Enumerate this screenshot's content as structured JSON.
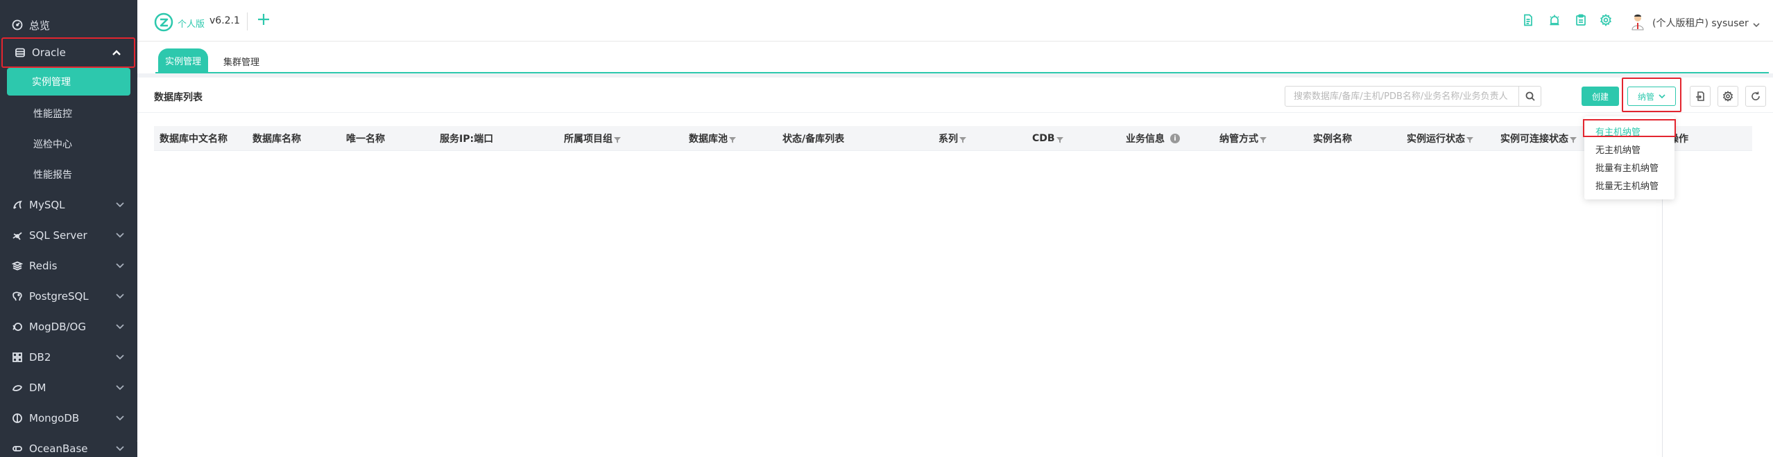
{
  "sidebar": {
    "items": [
      {
        "label": "总览",
        "icon": "dashboard-icon"
      },
      {
        "label": "Oracle",
        "icon": "database-icon",
        "expanded": true
      },
      {
        "label": "MySQL",
        "icon": "dolphin-icon"
      },
      {
        "label": "SQL Server",
        "icon": "sqlserver-icon"
      },
      {
        "label": "Redis",
        "icon": "stack-icon"
      },
      {
        "label": "PostgreSQL",
        "icon": "elephant-icon"
      },
      {
        "label": "MogDB/OG",
        "icon": "mogdb-icon"
      },
      {
        "label": "DB2",
        "icon": "db2-icon"
      },
      {
        "label": "DM",
        "icon": "dm-icon"
      },
      {
        "label": "MongoDB",
        "icon": "leaf-icon"
      },
      {
        "label": "OceanBase",
        "icon": "oceanbase-icon"
      }
    ],
    "oracle_sub": [
      {
        "label": "实例管理",
        "active": true
      },
      {
        "label": "性能监控"
      },
      {
        "label": "巡检中心"
      },
      {
        "label": "性能报告"
      }
    ]
  },
  "header": {
    "logo_text": "个人版",
    "version": "v6.2.1",
    "user": "(个人版租户) sysuser"
  },
  "tabs": [
    {
      "label": "实例管理",
      "active": true
    },
    {
      "label": "集群管理"
    }
  ],
  "main": {
    "title": "数据库列表",
    "search_placeholder": "搜索数据库/备库/主机/PDB名称/业务名称/业务负责人",
    "create_label": "创建",
    "manage_label": "纳管",
    "columns": [
      {
        "label": "数据库中文名称",
        "filter": false
      },
      {
        "label": "数据库名称",
        "filter": false
      },
      {
        "label": "唯一名称",
        "filter": false
      },
      {
        "label": "服务IP:端口",
        "filter": false
      },
      {
        "label": "所属项目组",
        "filter": true
      },
      {
        "label": "数据库池",
        "filter": true
      },
      {
        "label": "状态/备库列表",
        "filter": false
      },
      {
        "label": "系列",
        "filter": true
      },
      {
        "label": "CDB",
        "filter": true
      },
      {
        "label": "业务信息",
        "filter": false,
        "info": true
      },
      {
        "label": "纳管方式",
        "filter": true
      },
      {
        "label": "实例名称",
        "filter": false
      },
      {
        "label": "实例运行状态",
        "filter": true
      },
      {
        "label": "实例可连接状态",
        "filter": true
      },
      {
        "label": "操作",
        "filter": false
      }
    ]
  },
  "dropdown": {
    "items": [
      "有主机纳管",
      "无主机纳管",
      "批量有主机纳管",
      "批量无主机纳管"
    ]
  },
  "colors": {
    "accent": "#2dc8ad",
    "sidebar_bg": "#2b323d",
    "highlight_red": "#e3252f"
  }
}
